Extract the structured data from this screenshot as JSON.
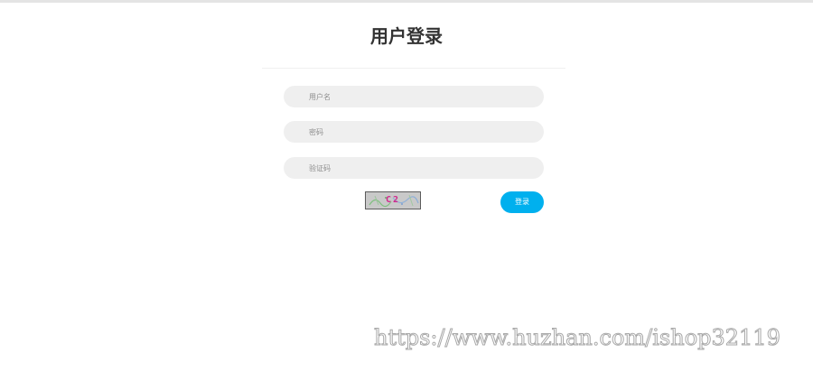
{
  "page": {
    "title": "用户登录"
  },
  "login_form": {
    "username_placeholder": "用户名",
    "password_placeholder": "密码",
    "captcha_placeholder": "验证码",
    "captcha_text": "C2",
    "login_button_label": "登录"
  },
  "watermark": {
    "text": "https://www.huzhan.com/ishop32119"
  },
  "colors": {
    "accent": "#00b0ee",
    "field_background": "#efefef",
    "title_text": "#333333"
  }
}
